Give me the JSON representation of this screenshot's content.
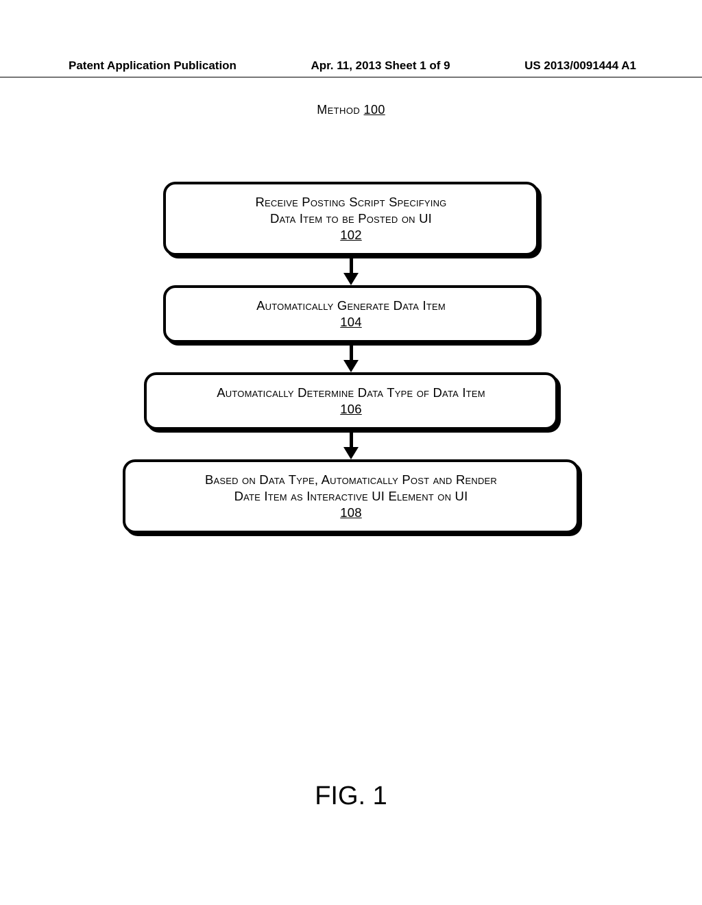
{
  "header": {
    "left": "Patent Application Publication",
    "center": "Apr. 11, 2013  Sheet 1 of 9",
    "right": "US 2013/0091444 A1"
  },
  "method": {
    "label": "Method",
    "number": "100"
  },
  "boxes": {
    "b1": {
      "line1": "Receive Posting Script Specifying",
      "line2": "Data Item to be Posted on UI",
      "ref": "102"
    },
    "b2": {
      "line1": "Automatically Generate Data Item",
      "ref": "104"
    },
    "b3": {
      "line1": "Automatically Determine Data Type of Data Item",
      "ref": "106"
    },
    "b4": {
      "line1": "Based on Data Type, Automatically Post and Render",
      "line2": "Date Item as Interactive UI Element on UI",
      "ref": "108"
    }
  },
  "figure_label": "FIG. 1"
}
